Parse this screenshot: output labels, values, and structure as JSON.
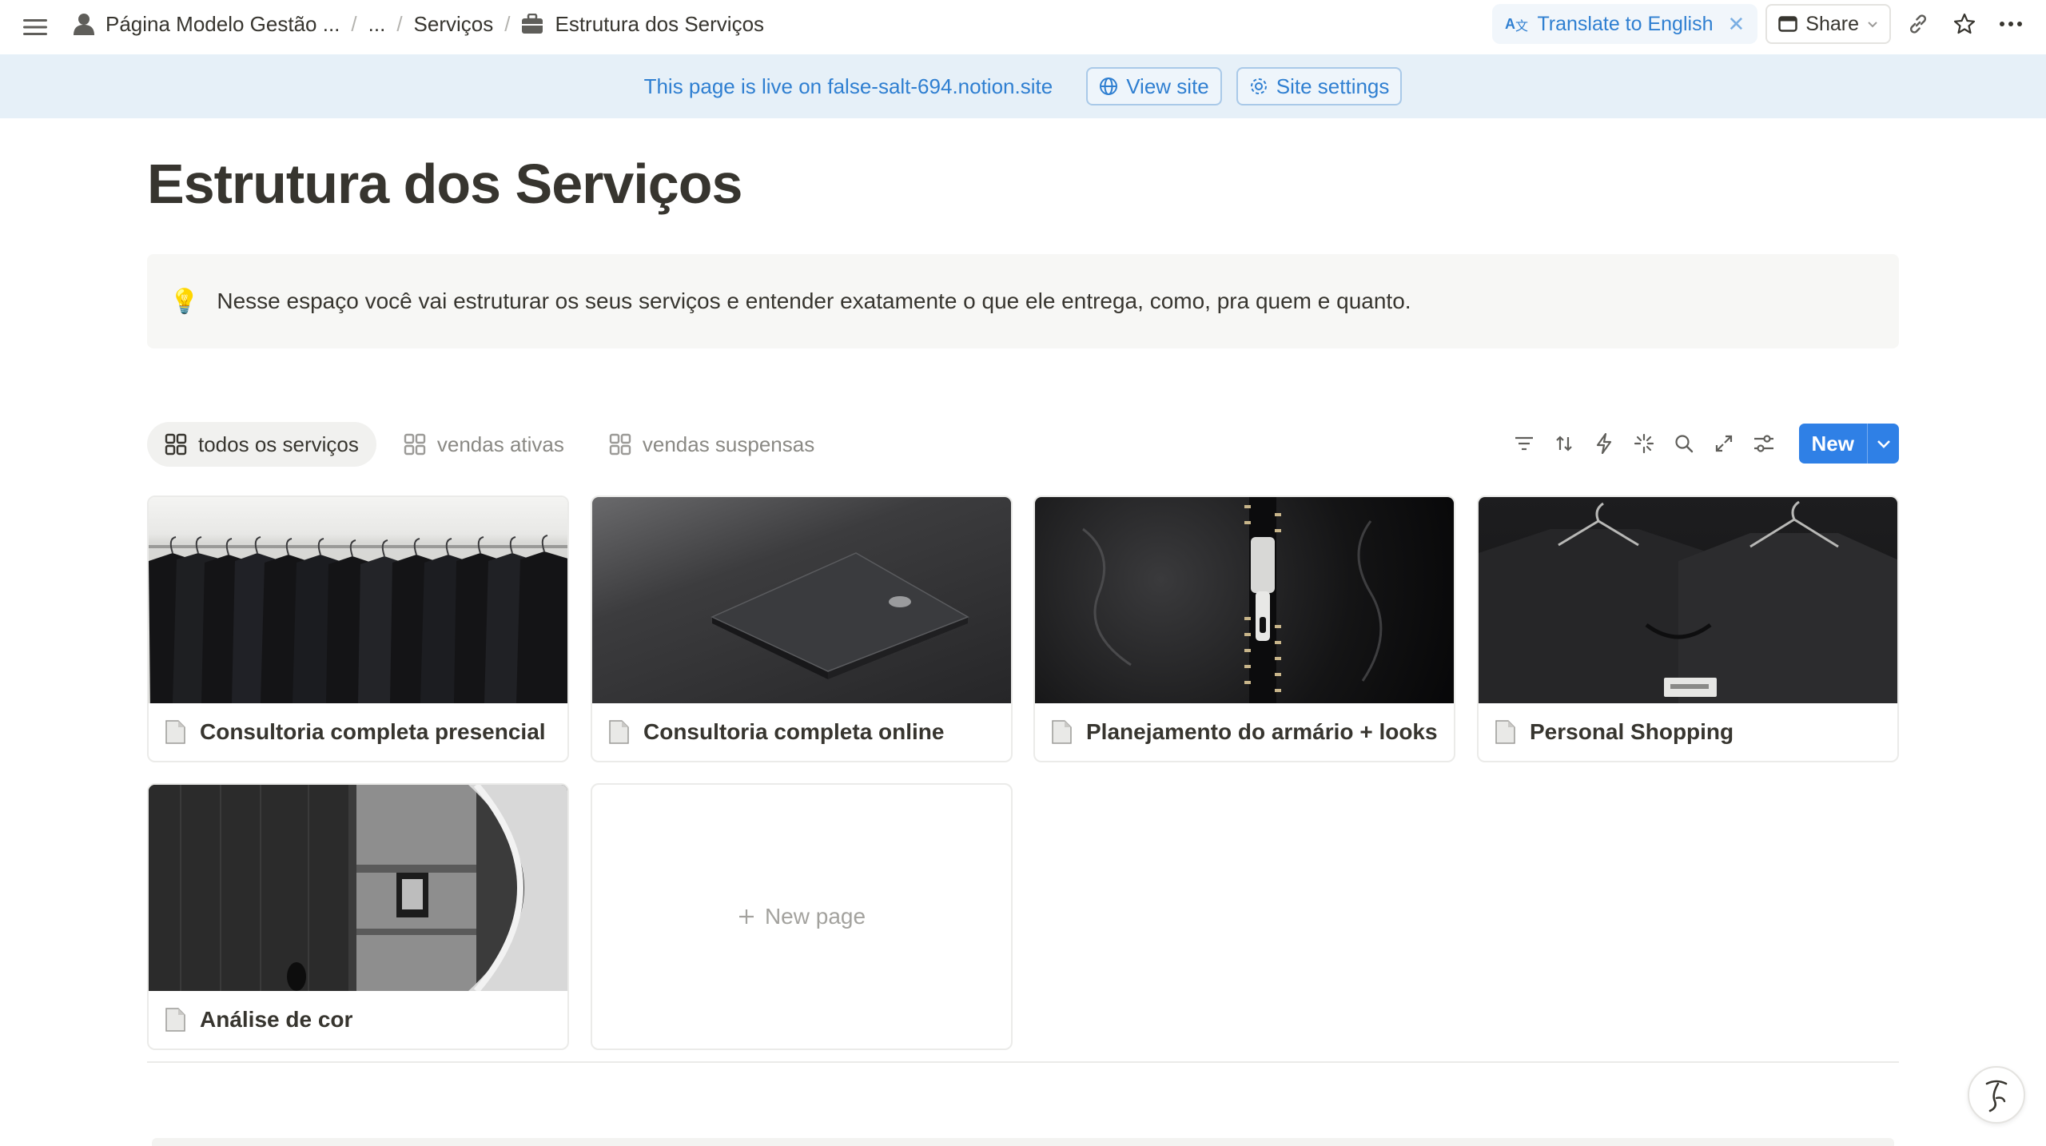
{
  "topbar": {
    "breadcrumbs": [
      "Página Modelo Gestão ...",
      "...",
      "Serviços",
      "Estrutura dos Serviços"
    ],
    "translate_label": "Translate to English",
    "share_label": "Share"
  },
  "banner": {
    "text": "This page is live on false-salt-694.notion.site",
    "view_site": "View site",
    "site_settings": "Site settings"
  },
  "page": {
    "title": "Estrutura dos Serviços",
    "callout_icon": "💡",
    "callout_text": "Nesse espaço você vai estruturar os seus serviços e entender exatamente o que ele entrega, como, pra quem e quanto."
  },
  "views": {
    "tabs": [
      {
        "label": "todos os serviços",
        "active": true
      },
      {
        "label": "vendas ativas",
        "active": false
      },
      {
        "label": "vendas suspensas",
        "active": false
      }
    ],
    "new_label": "New"
  },
  "gallery": {
    "cards": [
      {
        "title": "Consultoria completa presencial",
        "cover": "clothes-rack-photo"
      },
      {
        "title": "Consultoria completa online",
        "cover": "laptop-photo"
      },
      {
        "title": "Planejamento do armário + looks",
        "cover": "leather-zipper-photo"
      },
      {
        "title": "Personal Shopping",
        "cover": "hangers-tshirts-photo"
      },
      {
        "title": "Análise de cor",
        "cover": "mirror-room-photo"
      }
    ],
    "new_page_label": "New page"
  },
  "colors": {
    "accent": "#2f80e6",
    "banner_bg": "#e6f0f8",
    "banner_text": "#2f7fd1",
    "text": "#37352f"
  }
}
